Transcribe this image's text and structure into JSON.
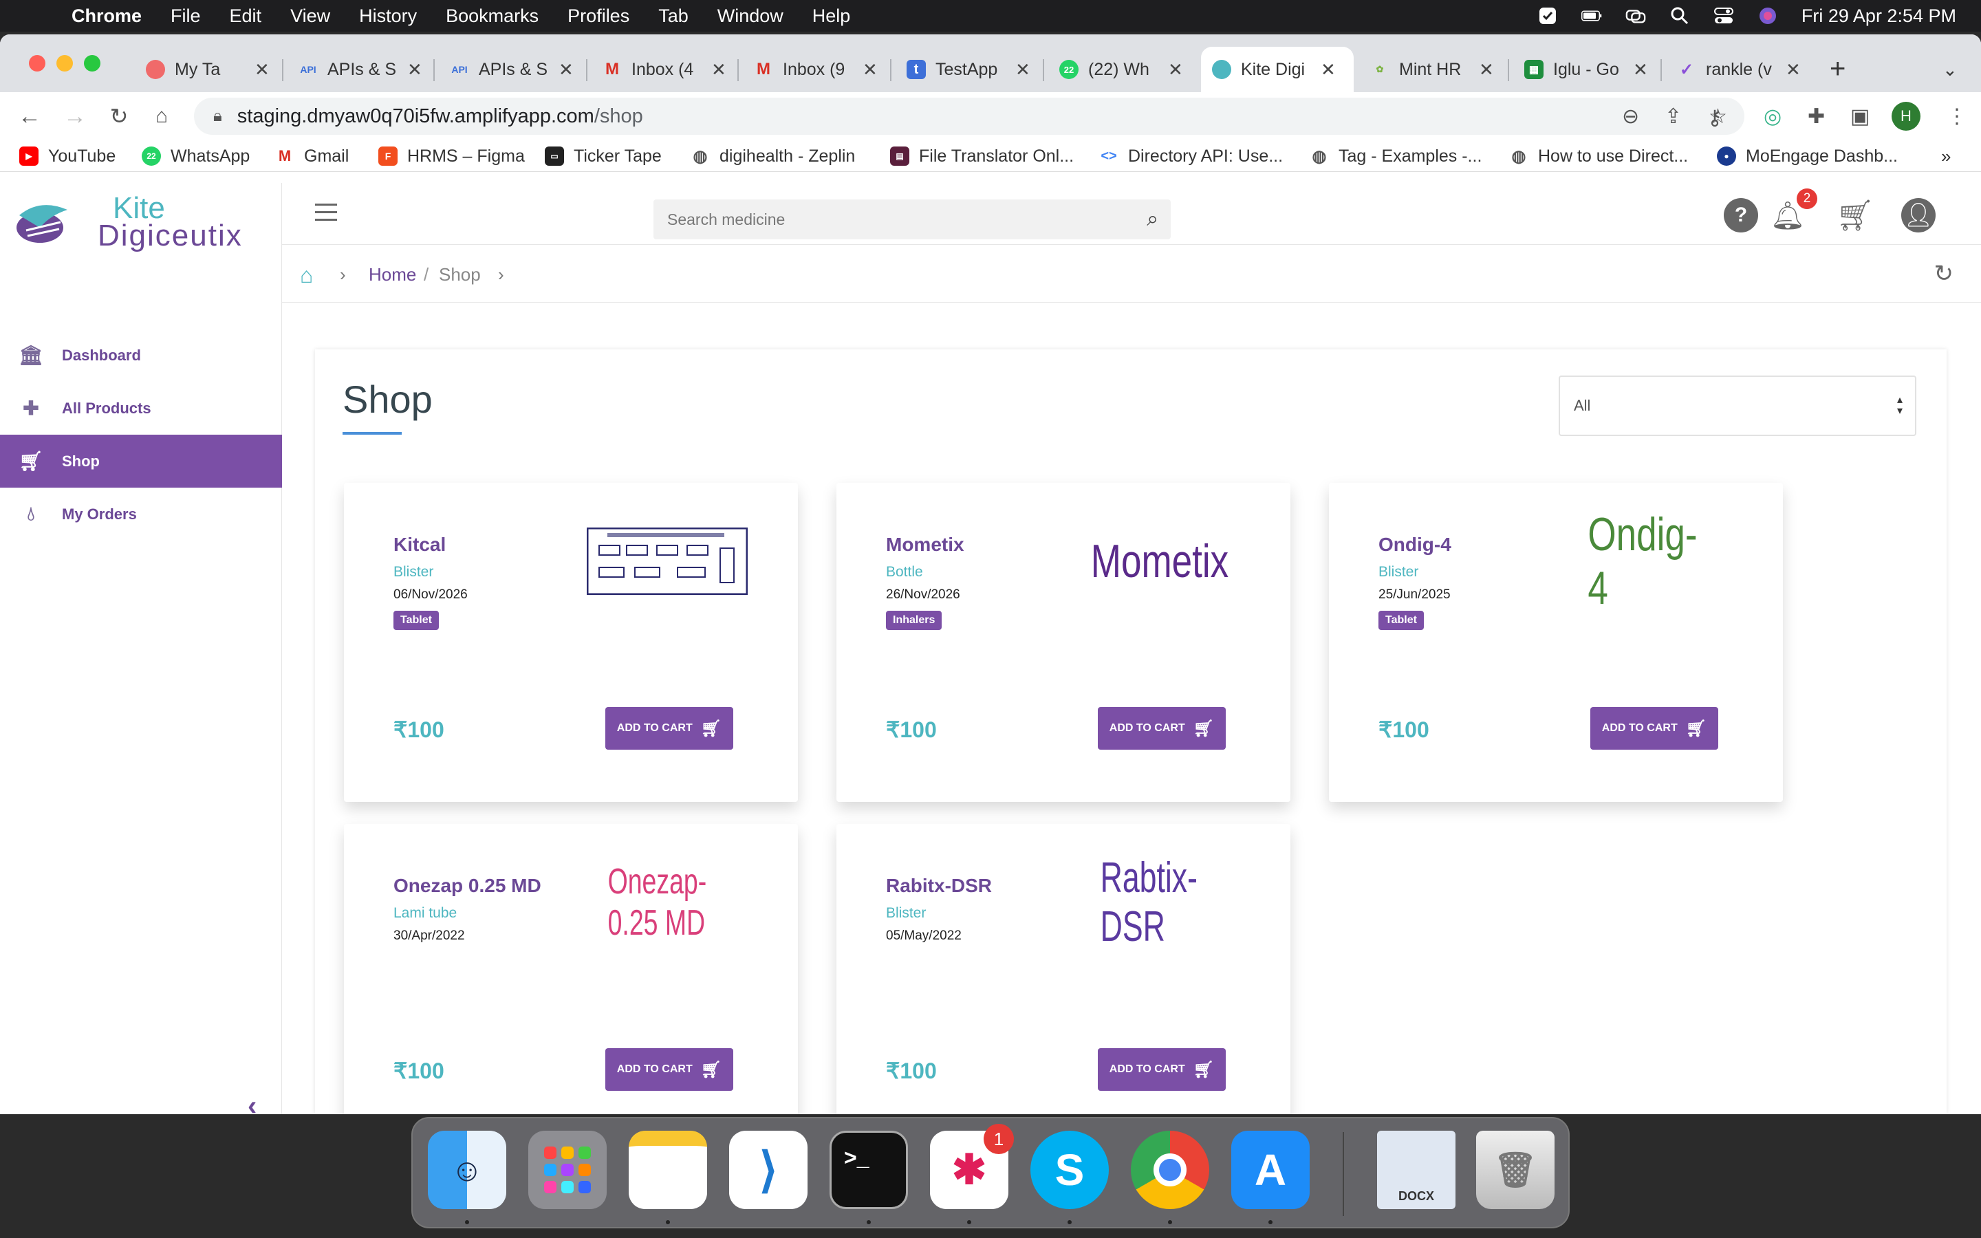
{
  "menubar": {
    "app": "Chrome",
    "items": [
      "File",
      "Edit",
      "View",
      "History",
      "Bookmarks",
      "Profiles",
      "Tab",
      "Window",
      "Help"
    ],
    "datetime": "Fri 29 Apr  2:54 PM"
  },
  "tabs": [
    {
      "label": "My Ta",
      "icon": "asana-icon"
    },
    {
      "label": "APIs & S",
      "icon": "api-icon"
    },
    {
      "label": "APIs & S",
      "icon": "api-icon"
    },
    {
      "label": "Inbox (4",
      "icon": "gmail-icon"
    },
    {
      "label": "Inbox (9",
      "icon": "gmail-icon"
    },
    {
      "label": "TestApp",
      "icon": "testapp-icon"
    },
    {
      "label": "(22) Wh",
      "icon": "whatsapp-icon"
    },
    {
      "label": "Kite Digi",
      "icon": "kite-icon",
      "active": true
    },
    {
      "label": "Mint HR",
      "icon": "minthr-icon"
    },
    {
      "label": "Iglu - Go",
      "icon": "sheets-icon"
    },
    {
      "label": "rankle (v",
      "icon": "rankle-icon"
    }
  ],
  "address": {
    "host": "staging.dmyaw0q70i5fw.amplifyapp.com",
    "path": "/shop"
  },
  "bookmarks": [
    {
      "label": "YouTube",
      "icon": "youtube-icon"
    },
    {
      "label": "WhatsApp",
      "icon": "whatsapp-icon"
    },
    {
      "label": "Gmail",
      "icon": "gmail-icon"
    },
    {
      "label": "HRMS – Figma",
      "icon": "figma-icon"
    },
    {
      "label": "Ticker Tape",
      "icon": "tickertape-icon"
    },
    {
      "label": "digihealth - Zeplin",
      "icon": "globe-icon"
    },
    {
      "label": "File Translator Onl...",
      "icon": "translator-icon"
    },
    {
      "label": "Directory API: Use...",
      "icon": "google-dev-icon"
    },
    {
      "label": "Tag - Examples -...",
      "icon": "globe-icon"
    },
    {
      "label": "How to use Direct...",
      "icon": "globe-icon"
    },
    {
      "label": "MoEngage Dashb...",
      "icon": "moengage-icon"
    }
  ],
  "sidebar": {
    "logo_line1": "Kite",
    "logo_line2": "Digiceutix",
    "items": [
      {
        "label": "Dashboard",
        "icon": "bank-icon"
      },
      {
        "label": "All Products",
        "icon": "plus-icon"
      },
      {
        "label": "Shop",
        "icon": "cart-icon",
        "active": true
      },
      {
        "label": "My Orders",
        "icon": "drop-icon"
      }
    ]
  },
  "header": {
    "search_placeholder": "Search medicine",
    "notification_count": "2"
  },
  "breadcrumb": {
    "home": "Home",
    "separator": "/",
    "current": "Shop"
  },
  "shop": {
    "title": "Shop",
    "filter_value": "All"
  },
  "products": [
    {
      "name": "Kitcal",
      "form": "Blister",
      "date": "06/Nov/2026",
      "badge": "Tablet",
      "price": "₹100",
      "button": "ADD TO CART",
      "image_text": ""
    },
    {
      "name": "Mometix",
      "form": "Bottle",
      "date": "26/Nov/2026",
      "badge": "Inhalers",
      "price": "₹100",
      "button": "ADD TO CART",
      "image_text": "Mometix"
    },
    {
      "name": "Ondig-4",
      "form": "Blister",
      "date": "25/Jun/2025",
      "badge": "Tablet",
      "price": "₹100",
      "button": "ADD TO CART",
      "image_text": "Ondig-4"
    },
    {
      "name": "Onezap 0.25 MD",
      "form": "Lami tube",
      "date": "30/Apr/2022",
      "badge": "",
      "price": "₹100",
      "button": "ADD TO CART",
      "image_text": "Onezap-0.25 MD"
    },
    {
      "name": "Rabitx-DSR",
      "form": "Blister",
      "date": "05/May/2022",
      "badge": "",
      "price": "₹100",
      "button": "ADD TO CART",
      "image_text": "Rabtix-DSR"
    }
  ],
  "dock": {
    "apps": [
      "Finder",
      "Launchpad",
      "Notes",
      "Visual Studio Code",
      "Terminal",
      "Slack",
      "Skype",
      "Google Chrome",
      "App Store",
      "DOCX",
      "Trash"
    ],
    "slack_badge": "1",
    "docx_label": "DOCX"
  },
  "colors": {
    "brand_purple": "#7b4fa6",
    "brand_teal": "#4db6c0"
  }
}
